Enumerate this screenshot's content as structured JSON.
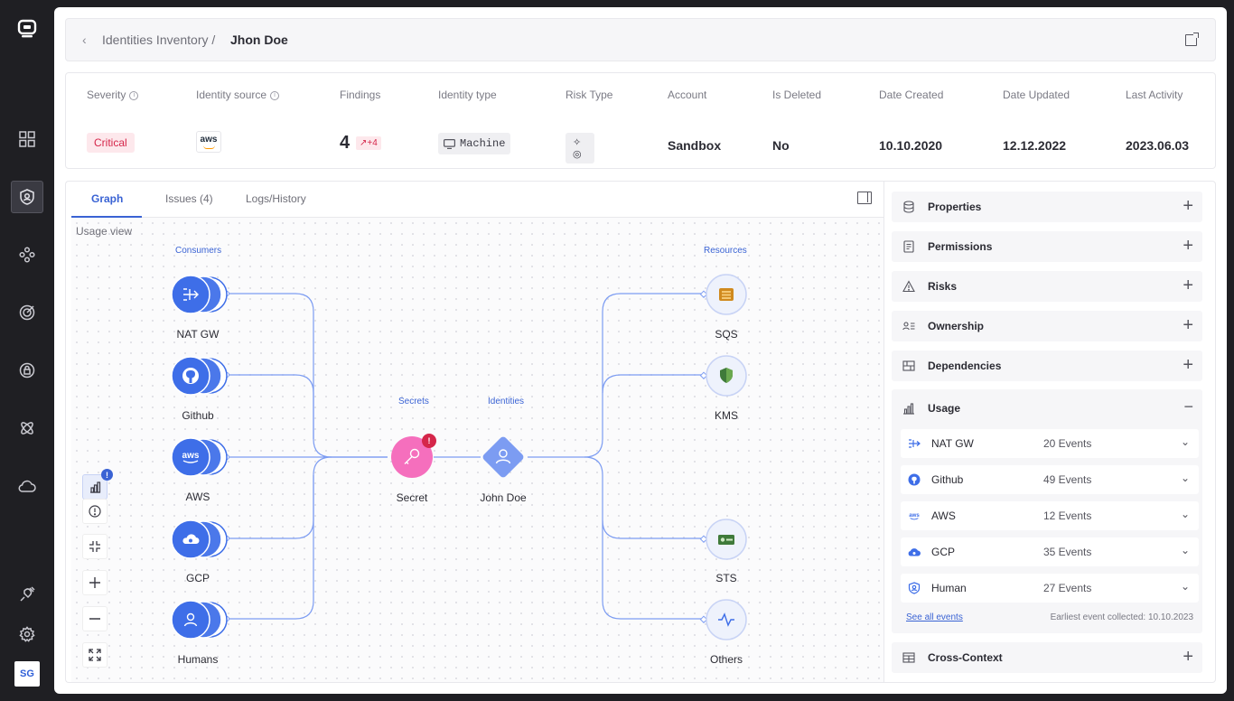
{
  "breadcrumb": {
    "parent": "Identities Inventory /",
    "current": "Jhon Doe"
  },
  "summary": {
    "severity": {
      "label": "Severity",
      "value": "Critical"
    },
    "identity_source": {
      "label": "Identity source",
      "value": "aws"
    },
    "findings": {
      "label": "Findings",
      "value": "4",
      "trend": "↗+4"
    },
    "identity_type": {
      "label": "Identity type",
      "value": "Machine"
    },
    "risk_type": {
      "label": "Risk Type",
      "icons": "✧ ◎"
    },
    "account": {
      "label": "Account",
      "value": "Sandbox"
    },
    "is_deleted": {
      "label": "Is Deleted",
      "value": "No"
    },
    "date_created": {
      "label": "Date Created",
      "value": "10.10.2020"
    },
    "date_updated": {
      "label": "Date Updated",
      "value": "12.12.2022"
    },
    "last_activity": {
      "label": "Last Activity",
      "value": "2023.06.03"
    }
  },
  "tabs": [
    {
      "label": "Graph"
    },
    {
      "label": "Issues (4)"
    },
    {
      "label": "Logs/History"
    }
  ],
  "graph": {
    "view_label": "Usage view",
    "groups": {
      "consumers": "Consumers",
      "secrets": "Secrets",
      "identities": "Identities",
      "resources": "Resources"
    },
    "consumers": [
      "NAT GW",
      "Github",
      "AWS",
      "GCP",
      "Humans"
    ],
    "secret": {
      "label": "Secret",
      "alert": "!"
    },
    "identity": {
      "label": "John Doe"
    },
    "resources": [
      "SQS",
      "KMS",
      "STS",
      "Others"
    ],
    "controls_badge": "!"
  },
  "sections": {
    "properties": "Properties",
    "permissions": "Permissions",
    "risks": "Risks",
    "ownership": "Ownership",
    "dependencies": "Dependencies",
    "usage": "Usage",
    "cross_context": "Cross-Context"
  },
  "usage": {
    "rows": [
      {
        "name": "NAT GW",
        "events": "20 Events"
      },
      {
        "name": "Github",
        "events": "49 Events"
      },
      {
        "name": "AWS",
        "events": "12 Events"
      },
      {
        "name": "GCP",
        "events": "35 Events"
      },
      {
        "name": "Human",
        "events": "27 Events"
      }
    ],
    "see_all": "See all events",
    "earliest": "Earliest event collected: 10.10.2023"
  },
  "user": {
    "initials": "SG"
  },
  "colors": {
    "accent": "#3a63d4",
    "critical": "#d5264a",
    "node_blue": "#3e6ee8",
    "secret_pink": "#f56fbd",
    "identity_blue": "#7c9cf2"
  }
}
